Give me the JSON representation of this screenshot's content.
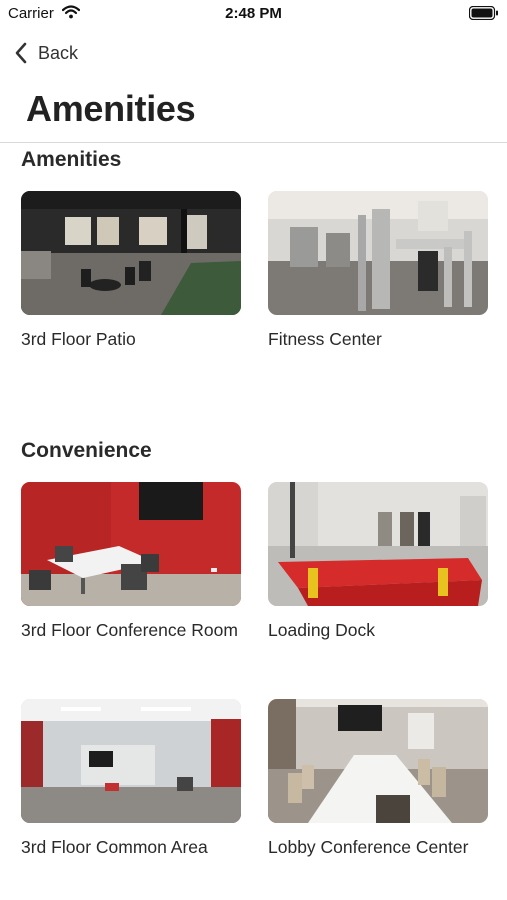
{
  "status_bar": {
    "carrier": "Carrier",
    "time": "2:48 PM"
  },
  "nav": {
    "back_label": "Back"
  },
  "page_title": "Amenities",
  "sections": [
    {
      "title": "Amenities",
      "items": [
        {
          "label": "3rd Floor Patio"
        },
        {
          "label": "Fitness Center"
        }
      ]
    },
    {
      "title": "Convenience",
      "items": [
        {
          "label": "3rd Floor Conference Room"
        },
        {
          "label": "Loading Dock"
        },
        {
          "label": "3rd Floor Common Area"
        },
        {
          "label": "Lobby Conference Center"
        }
      ]
    }
  ],
  "icons": {
    "back": "chevron-left-icon",
    "wifi": "wifi-icon",
    "battery": "battery-icon"
  }
}
